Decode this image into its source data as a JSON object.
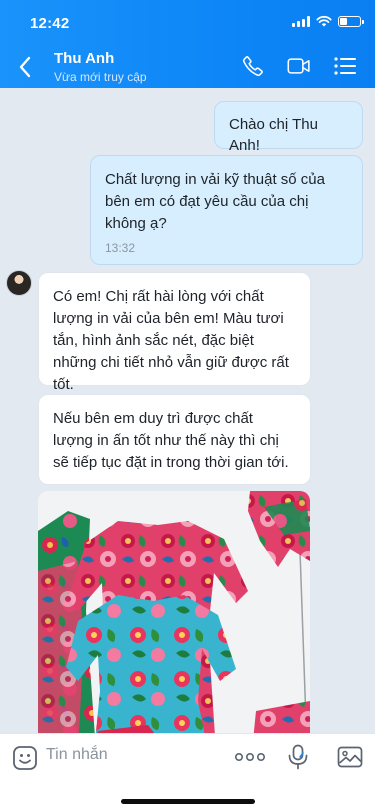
{
  "status_bar": {
    "time": "12:42"
  },
  "header": {
    "contact_name": "Thu Anh",
    "contact_status": "Vừa mới truy cập"
  },
  "messages": [
    {
      "direction": "out",
      "text": "Chào chị Thu Anh!"
    },
    {
      "direction": "out",
      "text": "Chất lượng in vải kỹ thuật số của bên em có đạt yêu cầu của chị không ạ?",
      "time": "13:32"
    },
    {
      "direction": "in",
      "text": "Có em! Chị rất hài lòng với chất lượng in vải của bên em! Màu tươi tắn, hình ảnh sắc nét, đặc biệt những chi tiết nhỏ vẫn giữ được rất tốt."
    },
    {
      "direction": "in",
      "text": "Nếu bên em duy trì được chất lượng in ấn tốt như thế này thì chị sẽ tiếp tục đặt in trong thời gian tới."
    }
  ],
  "input": {
    "placeholder": "Tin nhắn"
  },
  "colors": {
    "header_blue": "#0d86f7",
    "outgoing_bubble": "#d7eefe",
    "chat_bg": "#e3e9f1"
  },
  "icons": [
    "back-icon",
    "phone-icon",
    "video-call-icon",
    "menu-icon",
    "emoji-icon",
    "more-icon",
    "mic-icon",
    "image-icon"
  ]
}
